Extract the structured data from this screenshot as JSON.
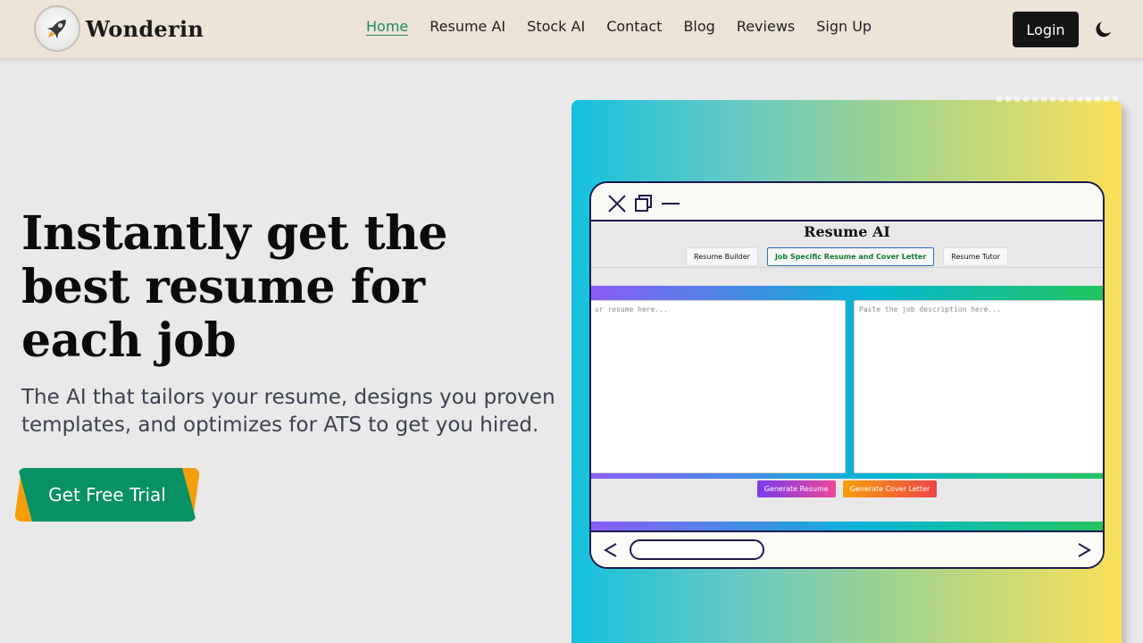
{
  "brand": {
    "name": "Wonderin",
    "logo_icon": "rocket-icon"
  },
  "nav": {
    "items": [
      {
        "label": "Home",
        "active": true
      },
      {
        "label": "Resume AI",
        "active": false
      },
      {
        "label": "Stock AI",
        "active": false
      },
      {
        "label": "Contact",
        "active": false
      },
      {
        "label": "Blog",
        "active": false
      },
      {
        "label": "Reviews",
        "active": false
      },
      {
        "label": "Sign Up",
        "active": false
      }
    ],
    "login_label": "Login",
    "theme_icon": "moon-icon"
  },
  "hero": {
    "title_line1": "Instantly get the",
    "title_line2": "best resume for",
    "title_line3": "each job",
    "subtitle": "The AI that tailors your resume, designs you proven templates, and optimizes for ATS to get you hired.",
    "cta_label": "Get Free Trial"
  },
  "preview": {
    "app_title": "Resume AI",
    "tabs": [
      {
        "label": "Resume Builder",
        "active": false
      },
      {
        "label": "Job Specific Resume and Cover Letter",
        "active": true
      },
      {
        "label": "Resume Tutor",
        "active": false
      }
    ],
    "resume_placeholder": "ur resume here...",
    "job_placeholder": "Paste the job description here...",
    "generate_resume_label": "Generate Resume",
    "generate_cover_label": "Generate Cover Letter",
    "window_icons": [
      "close-icon",
      "copy-icon",
      "minimize-icon"
    ],
    "back_icon": "chevron-left-icon",
    "forward_icon": "chevron-right-icon"
  },
  "colors": {
    "accent_green": "#089164",
    "accent_orange": "#f59e0b",
    "nav_bg": "#ede3d6",
    "active_link": "#1f8a63"
  }
}
